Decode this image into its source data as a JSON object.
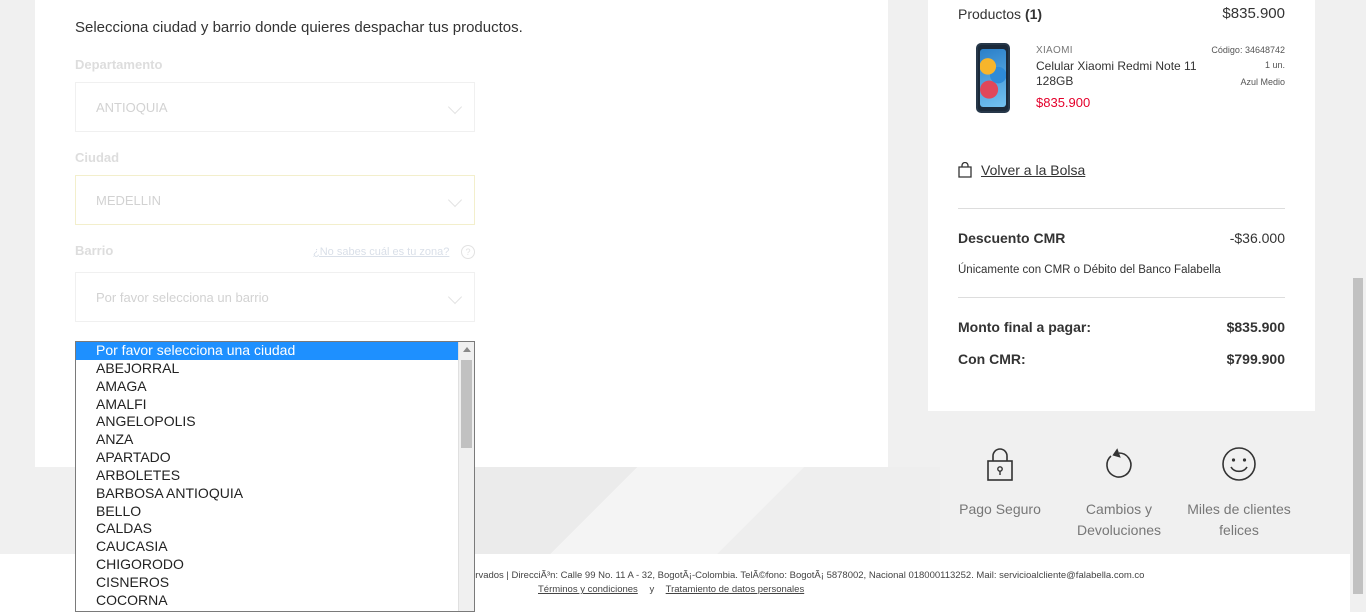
{
  "address_form": {
    "intro": "Selecciona ciudad y barrio donde quieres despachar tus productos.",
    "departamento_label": "Departamento",
    "departamento_value": "ANTIOQUIA",
    "ciudad_label": "Ciudad",
    "ciudad_value": "MEDELLIN",
    "barrio_label": "Barrio",
    "zone_help": "¿No sabes cuál es tu zona?",
    "zone_help_icon": "?",
    "barrio_placeholder": "Por favor selecciona un barrio"
  },
  "city_dropdown": {
    "options": [
      "Por favor selecciona una ciudad",
      "ABEJORRAL",
      "AMAGA",
      "AMALFI",
      "ANGELOPOLIS",
      "ANZA",
      "APARTADO",
      "ARBOLETES",
      "BARBOSA ANTIOQUIA",
      "BELLO",
      "CALDAS",
      "CAUCASIA",
      "CHIGORODO",
      "CISNEROS",
      "COCORNA"
    ],
    "selected_index": 0,
    "accent_color": "#1e90ff"
  },
  "summary": {
    "products_label": "Productos",
    "products_count": "(1)",
    "products_total": "$835.900",
    "product": {
      "brand": "XIAOMI",
      "name": "Celular Xiaomi Redmi Note 11 128GB",
      "price": "$835.900",
      "code": "Código: 34648742",
      "quantity": "1 un.",
      "color": "Azul Medio"
    },
    "back_link": "Volver a la Bolsa",
    "discount_label": "Descuento CMR",
    "discount_value": "-$36.000",
    "discount_note": "Únicamente con CMR o Débito del Banco Falabella",
    "final_label": "Monto final a pagar:",
    "final_value": "$835.900",
    "cmr_label": "Con CMR:",
    "cmr_value": "$799.900",
    "price_color": "#e4002b"
  },
  "badges": [
    {
      "icon": "padlock-icon",
      "label": "Pago Seguro"
    },
    {
      "icon": "refresh-icon",
      "label": "Cambios y Devoluciones"
    },
    {
      "icon": "smiley-icon",
      "label": "Miles de clientes felices"
    }
  ],
  "footer": {
    "line1": "ervados  |  DirecciÃ³n: Calle 99 No. 11 A - 32, BogotÃ¡-Colombia. TelÃ©fono: BogotÃ¡ 5878002, Nacional 018000113252. Mail: servicioalcliente@falabella.com.co",
    "terms_link": "Términos y condiciones",
    "separator": "y",
    "privacy_link": "Tratamiento de datos personales"
  }
}
